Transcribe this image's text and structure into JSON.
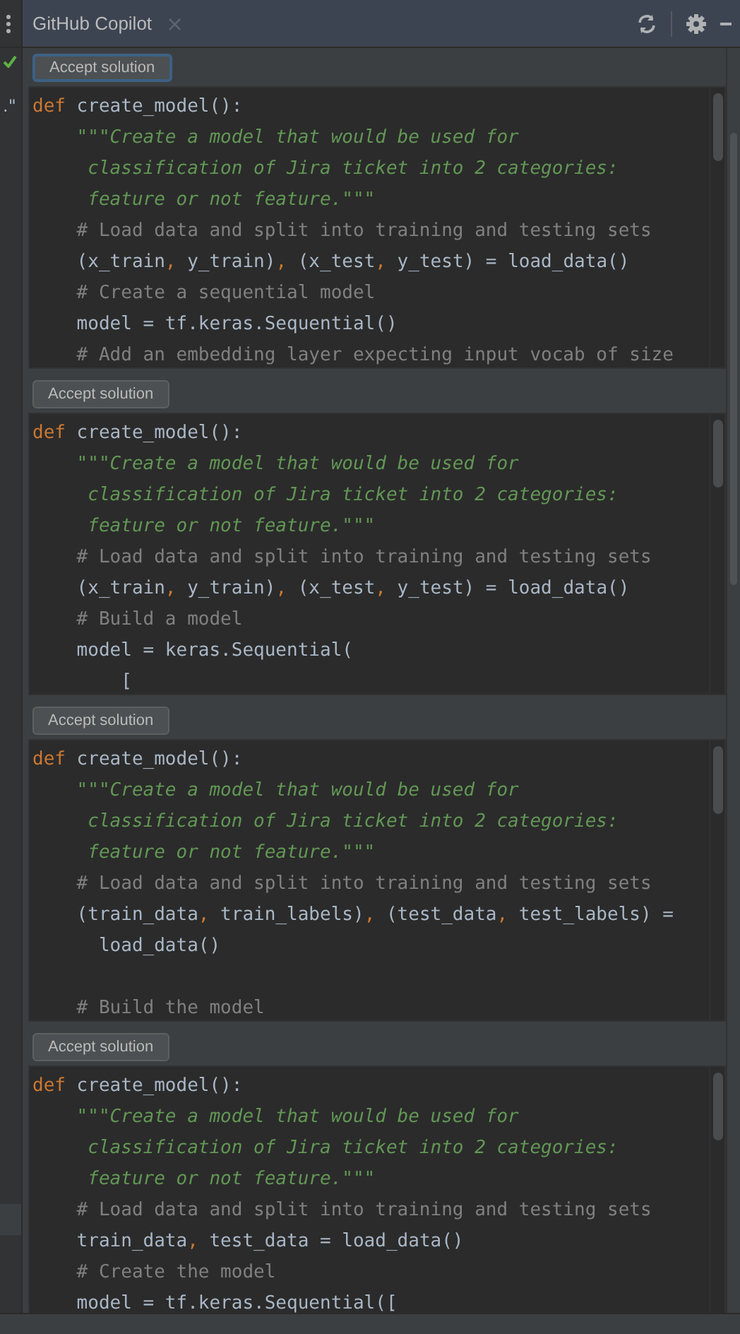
{
  "side_strip": {
    "mark": ".\""
  },
  "tool_window": {
    "title": "GitHub Copilot",
    "close": "×"
  },
  "solutions": [
    {
      "button": "Accept solution",
      "focused": true,
      "lines": [
        {
          "kind": "code",
          "spans": [
            {
              "kind": "kw",
              "text": "def"
            },
            {
              "kind": "plain",
              "text": " create_model():"
            }
          ]
        },
        {
          "kind": "code",
          "spans": [
            {
              "kind": "doc",
              "text": "    \"\"\"Create a model that would be used for"
            }
          ]
        },
        {
          "kind": "code",
          "spans": [
            {
              "kind": "doc",
              "text": "     classification of Jira ticket into 2 categories:"
            }
          ]
        },
        {
          "kind": "code",
          "spans": [
            {
              "kind": "doc",
              "text": "     feature or not feature.\"\"\""
            }
          ]
        },
        {
          "kind": "code",
          "spans": [
            {
              "kind": "comment",
              "text": "    # Load data and split into training and testing sets"
            }
          ]
        },
        {
          "kind": "code",
          "spans": [
            {
              "kind": "plain",
              "text": "    (x_train"
            },
            {
              "kind": "punct",
              "text": ","
            },
            {
              "kind": "plain",
              "text": " y_train)"
            },
            {
              "kind": "punct",
              "text": ","
            },
            {
              "kind": "plain",
              "text": " (x_test"
            },
            {
              "kind": "punct",
              "text": ","
            },
            {
              "kind": "plain",
              "text": " y_test) = load_data()"
            }
          ]
        },
        {
          "kind": "code",
          "spans": [
            {
              "kind": "comment",
              "text": "    # Create a sequential model"
            }
          ]
        },
        {
          "kind": "code",
          "spans": [
            {
              "kind": "plain",
              "text": "    model = tf.keras.Sequential()"
            }
          ]
        },
        {
          "kind": "code",
          "spans": [
            {
              "kind": "comment",
              "text": "    # Add an embedding layer expecting input vocab of size"
            }
          ]
        }
      ]
    },
    {
      "button": "Accept solution",
      "focused": false,
      "lines": [
        {
          "kind": "code",
          "spans": [
            {
              "kind": "kw",
              "text": "def"
            },
            {
              "kind": "plain",
              "text": " create_model():"
            }
          ]
        },
        {
          "kind": "code",
          "spans": [
            {
              "kind": "doc",
              "text": "    \"\"\"Create a model that would be used for"
            }
          ]
        },
        {
          "kind": "code",
          "spans": [
            {
              "kind": "doc",
              "text": "     classification of Jira ticket into 2 categories:"
            }
          ]
        },
        {
          "kind": "code",
          "spans": [
            {
              "kind": "doc",
              "text": "     feature or not feature.\"\"\""
            }
          ]
        },
        {
          "kind": "code",
          "spans": [
            {
              "kind": "comment",
              "text": "    # Load data and split into training and testing sets"
            }
          ]
        },
        {
          "kind": "code",
          "spans": [
            {
              "kind": "plain",
              "text": "    (x_train"
            },
            {
              "kind": "punct",
              "text": ","
            },
            {
              "kind": "plain",
              "text": " y_train)"
            },
            {
              "kind": "punct",
              "text": ","
            },
            {
              "kind": "plain",
              "text": " (x_test"
            },
            {
              "kind": "punct",
              "text": ","
            },
            {
              "kind": "plain",
              "text": " y_test) = load_data()"
            }
          ]
        },
        {
          "kind": "code",
          "spans": [
            {
              "kind": "comment",
              "text": "    # Build a model"
            }
          ]
        },
        {
          "kind": "code",
          "spans": [
            {
              "kind": "plain",
              "text": "    model = keras.Sequential("
            }
          ]
        },
        {
          "kind": "code",
          "spans": [
            {
              "kind": "plain",
              "text": "        ["
            }
          ]
        }
      ]
    },
    {
      "button": "Accept solution",
      "focused": false,
      "lines": [
        {
          "kind": "code",
          "spans": [
            {
              "kind": "kw",
              "text": "def"
            },
            {
              "kind": "plain",
              "text": " create_model():"
            }
          ]
        },
        {
          "kind": "code",
          "spans": [
            {
              "kind": "doc",
              "text": "    \"\"\"Create a model that would be used for"
            }
          ]
        },
        {
          "kind": "code",
          "spans": [
            {
              "kind": "doc",
              "text": "     classification of Jira ticket into 2 categories:"
            }
          ]
        },
        {
          "kind": "code",
          "spans": [
            {
              "kind": "doc",
              "text": "     feature or not feature.\"\"\""
            }
          ]
        },
        {
          "kind": "code",
          "spans": [
            {
              "kind": "comment",
              "text": "    # Load data and split into training and testing sets"
            }
          ]
        },
        {
          "kind": "code",
          "spans": [
            {
              "kind": "plain",
              "text": "    (train_data"
            },
            {
              "kind": "punct",
              "text": ","
            },
            {
              "kind": "plain",
              "text": " train_labels)"
            },
            {
              "kind": "punct",
              "text": ","
            },
            {
              "kind": "plain",
              "text": " (test_data"
            },
            {
              "kind": "punct",
              "text": ","
            },
            {
              "kind": "plain",
              "text": " test_labels) ="
            }
          ]
        },
        {
          "kind": "code",
          "spans": [
            {
              "kind": "plain",
              "text": "      load_data()"
            }
          ]
        },
        {
          "kind": "blank"
        },
        {
          "kind": "code",
          "spans": [
            {
              "kind": "comment",
              "text": "    # Build the model"
            }
          ]
        }
      ]
    },
    {
      "button": "Accept solution",
      "focused": false,
      "lines": [
        {
          "kind": "code",
          "spans": [
            {
              "kind": "kw",
              "text": "def"
            },
            {
              "kind": "plain",
              "text": " create_model():"
            }
          ]
        },
        {
          "kind": "code",
          "spans": [
            {
              "kind": "doc",
              "text": "    \"\"\"Create a model that would be used for"
            }
          ]
        },
        {
          "kind": "code",
          "spans": [
            {
              "kind": "doc",
              "text": "     classification of Jira ticket into 2 categories:"
            }
          ]
        },
        {
          "kind": "code",
          "spans": [
            {
              "kind": "doc",
              "text": "     feature or not feature.\"\"\""
            }
          ]
        },
        {
          "kind": "code",
          "spans": [
            {
              "kind": "comment",
              "text": "    # Load data and split into training and testing sets"
            }
          ]
        },
        {
          "kind": "code",
          "spans": [
            {
              "kind": "plain",
              "text": "    train_data"
            },
            {
              "kind": "punct",
              "text": ","
            },
            {
              "kind": "plain",
              "text": " test_data = load_data()"
            }
          ]
        },
        {
          "kind": "code",
          "spans": [
            {
              "kind": "comment",
              "text": "    # Create the model"
            }
          ]
        },
        {
          "kind": "code",
          "spans": [
            {
              "kind": "plain",
              "text": "    model = tf.keras.Sequential(["
            }
          ]
        }
      ]
    }
  ]
}
